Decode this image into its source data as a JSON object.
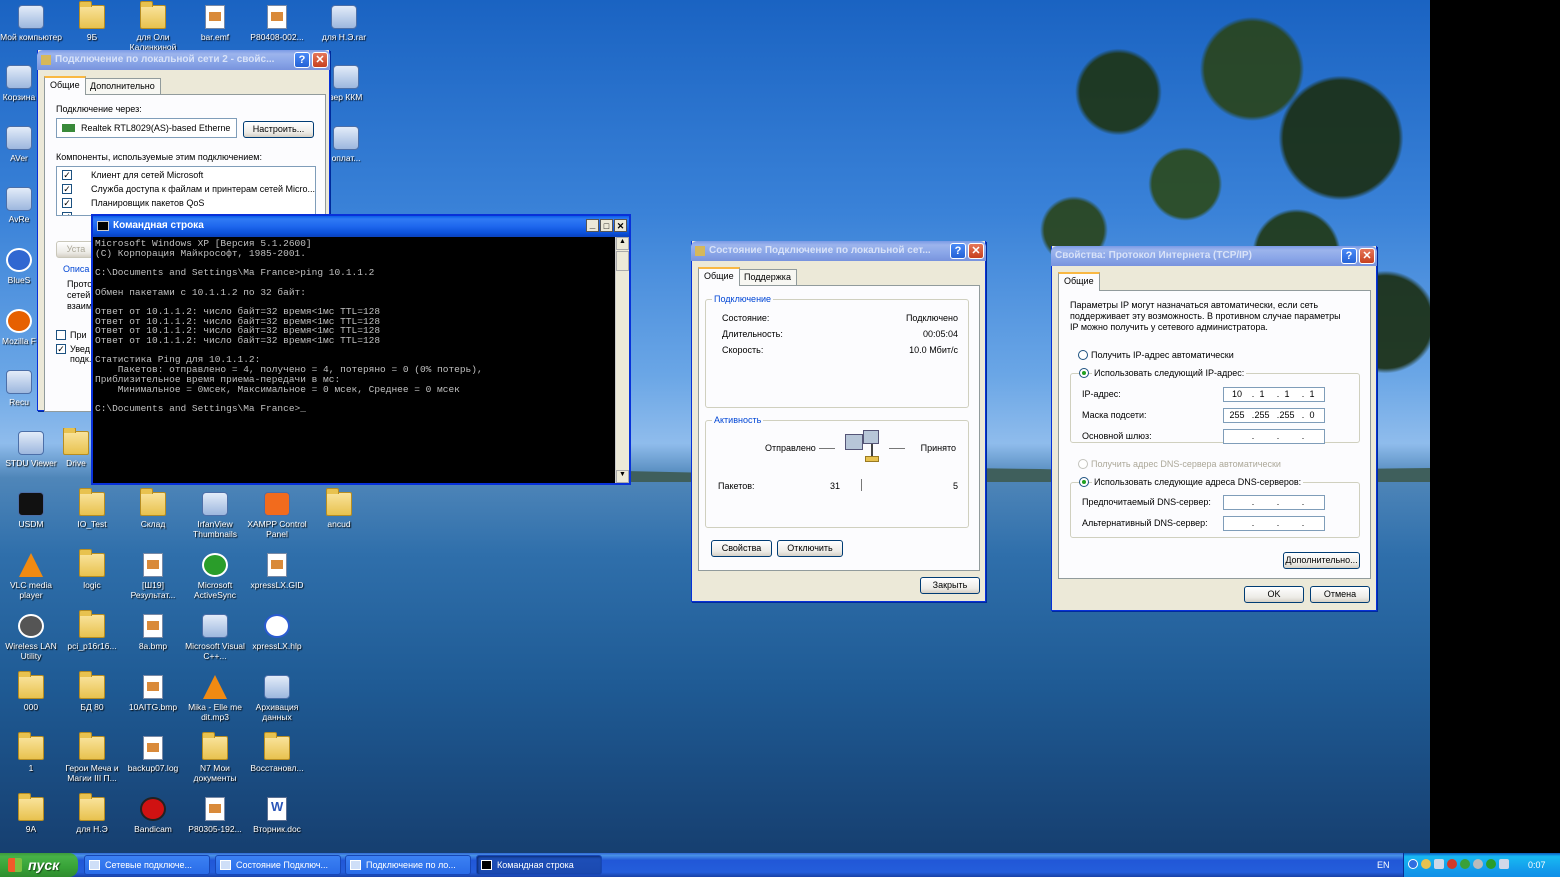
{
  "desktop_icons": [
    {
      "label": "Мой компьютер"
    },
    {
      "label": "9Б"
    },
    {
      "label": "для Оли Калинкиной"
    },
    {
      "label": "bar.emf"
    },
    {
      "label": "P80408-002..."
    },
    {
      "label": "для Н.Э.rar"
    },
    {
      "label": "Корзина"
    },
    {
      "label": "зер ККМ"
    },
    {
      "label": "AVer"
    },
    {
      "label": "оплат..."
    },
    {
      "label": "AvRe"
    },
    {
      "label": "BlueS"
    },
    {
      "label": "Mozilla F"
    },
    {
      "label": "Recu"
    },
    {
      "label": "STDU Viewer"
    },
    {
      "label": "Drive"
    },
    {
      "label": "USDM"
    },
    {
      "label": "IO_Test"
    },
    {
      "label": "Склад"
    },
    {
      "label": "IrfanView Thumbnails"
    },
    {
      "label": "XAMPP Control Panel"
    },
    {
      "label": "ancud"
    },
    {
      "label": "VLC media player"
    },
    {
      "label": "logic"
    },
    {
      "label": "[Ш19] Результат..."
    },
    {
      "label": "Microsoft ActiveSync"
    },
    {
      "label": "xpressLX.GID"
    },
    {
      "label": "Wireless LAN Utility"
    },
    {
      "label": "pci_p16r16..."
    },
    {
      "label": "8a.bmp"
    },
    {
      "label": "Microsoft Visual C++..."
    },
    {
      "label": "xpressLX.hlp"
    },
    {
      "label": "000"
    },
    {
      "label": "БД 80"
    },
    {
      "label": "10AITG.bmp"
    },
    {
      "label": "Mika - Elle me dit.mp3"
    },
    {
      "label": "Архивация данных"
    },
    {
      "label": "1"
    },
    {
      "label": "Герои Меча и Магии III П..."
    },
    {
      "label": "backup07.log"
    },
    {
      "label": "N7 Мои документы"
    },
    {
      "label": "Восстановл..."
    },
    {
      "label": "9А"
    },
    {
      "label": "для Н.Э"
    },
    {
      "label": "Bandicam"
    },
    {
      "label": "P80305-192..."
    },
    {
      "label": "Вторник.doc"
    }
  ],
  "lan_props": {
    "title": "Подключение по локальной сети 2 - свойс...",
    "tab_general": "Общие",
    "tab_advanced": "Дополнительно",
    "connect_via_label": "Подключение через:",
    "adapter": "Realtek RTL8029(AS)-based Etherne",
    "configure_btn": "Настроить...",
    "components_label": "Компоненты, используемые этим подключением:",
    "components": [
      "Клиент для сетей Microsoft",
      "Служба доступа к файлам и принтерам сетей Micro...",
      "Планировщик пакетов QoS"
    ],
    "install_btn": "Уста",
    "desc_label": "Описа",
    "desc_text": [
      "Прото",
      "сетей",
      "взаим"
    ],
    "chk1": "При",
    "chk2": "Увед",
    "chk2b": "подк."
  },
  "cmd": {
    "title": "Командная строка",
    "lines": [
      "Microsoft Windows XP [Версия 5.1.2600]",
      "(С) Корпорация Майкрософт, 1985-2001.",
      "",
      "C:\\Documents and Settings\\Ma France>ping 10.1.1.2",
      "",
      "Обмен пакетами с 10.1.1.2 по 32 байт:",
      "",
      "Ответ от 10.1.1.2: число байт=32 время<1мс TTL=128",
      "Ответ от 10.1.1.2: число байт=32 время<1мс TTL=128",
      "Ответ от 10.1.1.2: число байт=32 время<1мс TTL=128",
      "Ответ от 10.1.1.2: число байт=32 время<1мс TTL=128",
      "",
      "Статистика Ping для 10.1.1.2:",
      "    Пакетов: отправлено = 4, получено = 4, потеряно = 0 (0% потерь),",
      "Приблизительное время приема-передачи в мс:",
      "    Минимальное = 0мсек, Максимальное = 0 мсек, Среднее = 0 мсек",
      "",
      "C:\\Documents and Settings\\Ma France>_"
    ]
  },
  "status": {
    "title": "Состояние Подключение по локальной сет...",
    "tab_general": "Общие",
    "tab_support": "Поддержка",
    "group_conn": "Подключение",
    "state_label": "Состояние:",
    "state_value": "Подключено",
    "duration_label": "Длительность:",
    "duration_value": "00:05:04",
    "speed_label": "Скорость:",
    "speed_value": "10.0 Мбит/с",
    "group_activity": "Активность",
    "sent_label": "Отправлено",
    "recv_label": "Принято",
    "packets_label": "Пакетов:",
    "packets_sent": "31",
    "packets_recv": "5",
    "props_btn": "Свойства",
    "disable_btn": "Отключить",
    "close_btn": "Закрыть"
  },
  "tcpip": {
    "title": "Свойства: Протокол Интернета (TCP/IP)",
    "tab_general": "Общие",
    "intro": [
      "Параметры IP могут назначаться автоматически, если сеть",
      "поддерживает эту возможность. В противном случае параметры",
      "IP можно получить у сетевого администратора."
    ],
    "auto_ip": "Получить IP-адрес автоматически",
    "manual_ip": "Использовать следующий IP-адрес:",
    "ip_label": "IP-адрес:",
    "ip": [
      "10",
      "1",
      "1",
      "1"
    ],
    "mask_label": "Маска подсети:",
    "mask": [
      "255",
      "255",
      "255",
      "0"
    ],
    "gw_label": "Основной шлюз:",
    "auto_dns": "Получить адрес DNS-сервера автоматически",
    "manual_dns": "Использовать следующие адреса DNS-серверов:",
    "dns1_label": "Предпочитаемый DNS-сервер:",
    "dns2_label": "Альтернативный DNS-сервер:",
    "advanced_btn": "Дополнительно...",
    "ok_btn": "OK",
    "cancel_btn": "Отмена"
  },
  "taskbar": {
    "start": "пуск",
    "tasks": [
      "Сетевые подключе...",
      "Состояние Подключ...",
      "Подключение по ло...",
      "Командная строка"
    ],
    "lang": "EN",
    "clock": "0:07"
  }
}
